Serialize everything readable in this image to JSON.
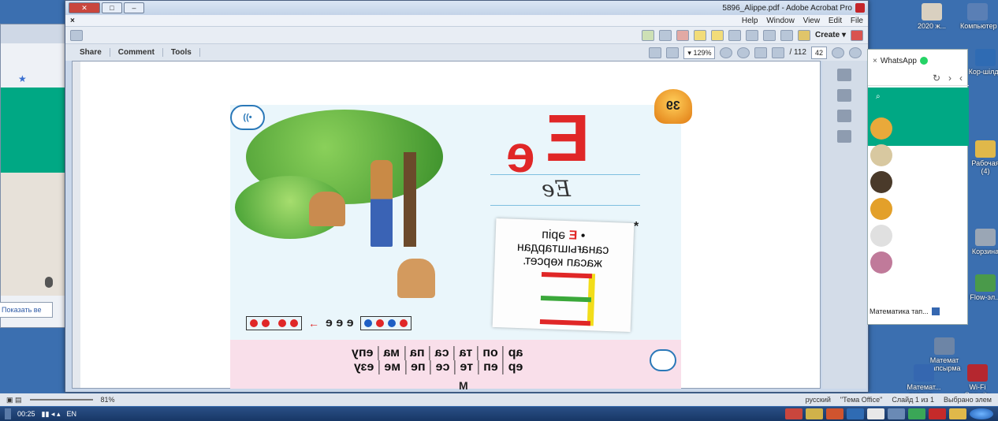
{
  "window": {
    "title": "5896_Alippe.pdf - Adobe Acrobat Pro",
    "close_x": "×",
    "min": "–",
    "max": "□",
    "close": "✕"
  },
  "menu": {
    "items": [
      "File",
      "Edit",
      "View",
      "Window",
      "Help"
    ]
  },
  "toolbar": {
    "create_label": "Create",
    "page_current": "42",
    "page_total": "/ 112",
    "zoom": "129%",
    "panes": [
      "Tools",
      "Comment",
      "Share"
    ]
  },
  "page": {
    "badge_number": "39",
    "letter_upper": "Е",
    "letter_lower": "е",
    "script_letters": "Ее",
    "card_bullet": "•",
    "card_letter": "Е",
    "card_text_1": "әріп",
    "card_text_2": "санағыштардан",
    "card_text_3": "жасап көрсет.",
    "asterisk": "*",
    "sound_row": "е е е",
    "arrow": "←",
    "syllables_row1": [
      "ар",
      "оп",
      "та",
      "са",
      "па",
      "ма",
      "епу"
    ],
    "syllables_row2": [
      "ер",
      "еп",
      "те",
      "се",
      "пе",
      "ме",
      "езу"
    ],
    "bottom_letter": "М"
  },
  "whatsapp": {
    "title": "WhatsApp",
    "chat_label": "Математика тап..."
  },
  "left_window": {
    "button_label": "Показать ве"
  },
  "ppt_status": {
    "slide": "Слайд 1 из 1",
    "theme": "\"Тема Office\"",
    "lang": "русский",
    "zoom": "81%",
    "chosen": "Выбрано элем"
  },
  "desktop_icons": [
    {
      "label": "Компьютер",
      "color": "#5a7fb5"
    },
    {
      "label": "2020 ж...",
      "color": "#d9d0c0"
    },
    {
      "label": "Кор-шілдэ",
      "color": "#2f6bb3"
    },
    {
      "label": "Рабочая (4)",
      "color": "#e0b84a"
    },
    {
      "label": "Корзина",
      "color": "#9aa6b5"
    },
    {
      "label": "Flow-эл...",
      "color": "#4a9a4a"
    },
    {
      "label": "Математ тапсырма",
      "color": "#6d85a6"
    },
    {
      "label": "Математ... тапсыр...",
      "color": "#3567b0"
    },
    {
      "label": "Wi-Fi Security 3...",
      "color": "#b5272f"
    }
  ],
  "taskbar": {
    "time": "00:25",
    "lang": "EN"
  },
  "colors": {
    "accent_red": "#e02727",
    "whatsapp_green": "#00a884",
    "blue_dot": "#1f5fc4",
    "red_dot": "#e02727"
  }
}
